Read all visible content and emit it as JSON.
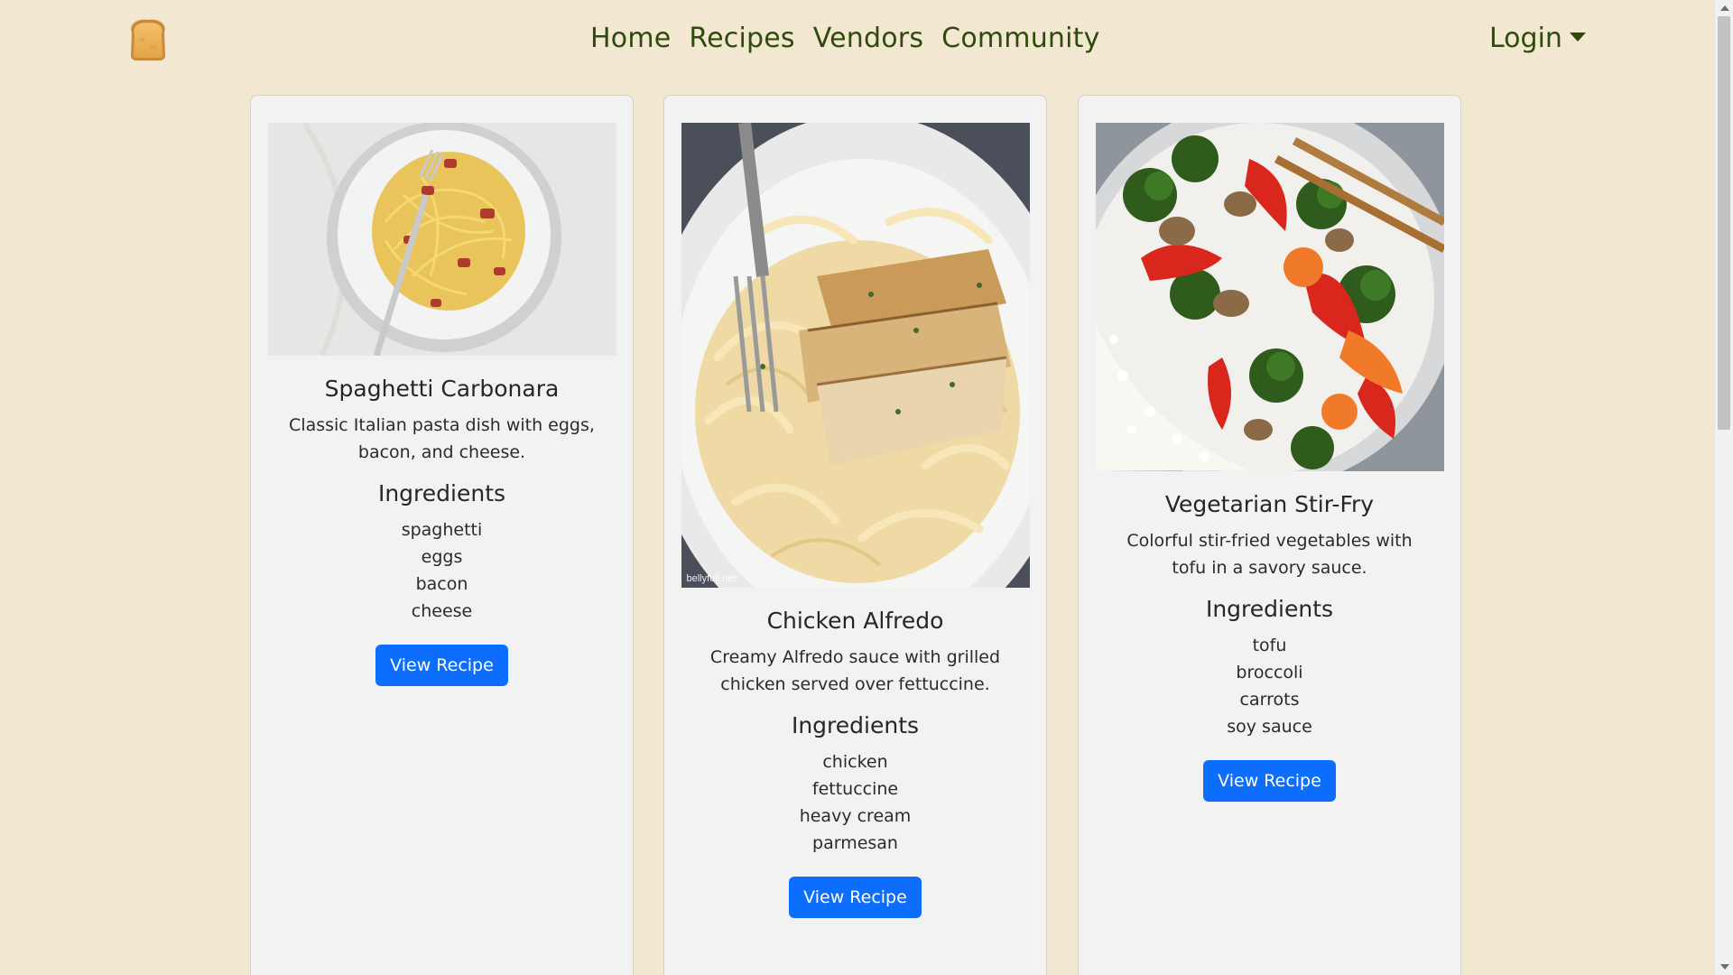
{
  "nav": {
    "logo_icon": "toast-bread-icon",
    "links": [
      "Home",
      "Recipes",
      "Vendors",
      "Community"
    ],
    "login_label": "Login"
  },
  "colors": {
    "page_background": "#f2e7d0",
    "nav_text": "#2f4a0d",
    "card_background": "#f2f2f2",
    "button": "#0d6efd"
  },
  "recipes": [
    {
      "title": "Spaghetti Carbonara",
      "description": "Classic Italian pasta dish with eggs, bacon, and cheese.",
      "ingredients_heading": "Ingredients",
      "ingredients": [
        "spaghetti",
        "eggs",
        "bacon",
        "cheese"
      ],
      "button_label": "View Recipe",
      "image_icon": "spaghetti-carbonara-photo"
    },
    {
      "title": "Chicken Alfredo",
      "description": "Creamy Alfredo sauce with grilled chicken served over fettuccine.",
      "ingredients_heading": "Ingredients",
      "ingredients": [
        "chicken",
        "fettuccine",
        "heavy cream",
        "parmesan"
      ],
      "button_label": "View Recipe",
      "image_icon": "chicken-alfredo-photo",
      "image_watermark": "bellyfull.net"
    },
    {
      "title": "Vegetarian Stir-Fry",
      "description": "Colorful stir-fried vegetables with tofu in a savory sauce.",
      "ingredients_heading": "Ingredients",
      "ingredients": [
        "tofu",
        "broccoli",
        "carrots",
        "soy sauce"
      ],
      "button_label": "View Recipe",
      "image_icon": "vegetarian-stir-fry-photo"
    }
  ]
}
